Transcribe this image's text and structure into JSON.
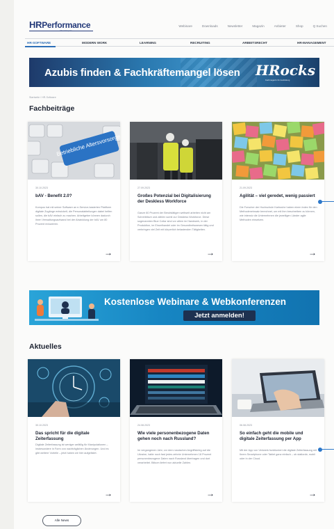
{
  "header": {
    "logo_hr": "HR",
    "logo_performance": "Performance",
    "logo_tagline": "Wissen für Experten",
    "top_links": [
      "Webinare",
      "Downloads",
      "Newsletter",
      "Magazin",
      "Anbieter",
      "Shop",
      "Q Suchen"
    ]
  },
  "nav": {
    "items": [
      "HR-SOFTWARE",
      "MODERN WORK",
      "LEARNING",
      "RECRUITING",
      "ARBEITSRECHT",
      "HR-MANAGEMENT"
    ],
    "active": "HR-SOFTWARE"
  },
  "banner_top": {
    "text": "Azubis finden & Fachkräftemangel lösen",
    "brand": "HRocks",
    "brand_sub": "Fachmagazin für Ausbildung"
  },
  "breadcrumb": "Startseite / HR-Software",
  "fachbeitraege": {
    "title": "Fachbeiträge",
    "cards": [
      {
        "image_label": "Betriebliche Altersvorsorge",
        "date": "30.10.2023",
        "title": "bAV - Benefit 2.0?",
        "body": "Kompus hat mit seiner Software an e-Service-basierten Plattform digitale Zugänge entwickelt, die Personalabteilungen dabei helfen sollen, die bAV einfach zu machen. Arbeitgeber können dadurch ihren Verwaltungsaufwand bei der Abwicklung der bAV um 80 Prozent reduzieren."
      },
      {
        "date": "27.09.2023",
        "title": "Großes Potenzial bei Digitalisierung der Deskless Workforce",
        "body": "Ganze 80 Prozent der Berufstätigen weltweit arbeiten nicht am Schreibtisch und zählen somit zur Deskless Workforce. Diese sogenannten Blue Collar sind vor allem im Handwerk, in der Produktion, im Einzelhandel oder im Gesundheitswesen tätig und verbringen viel Zeit mit körperlich belastenden Tätigkeiten."
      },
      {
        "date": "21.09.2023",
        "title": "Agilität – viel geredet, wenig passiert",
        "body": "Die Forscher der Hochschule Karlsruhe haben einen Index für den Methodeneinsatz berechnet, um mit ihm beschreiben zu können, wie intensiv die Unternehmen die jeweiligen Länder agile Methoden einsetzen."
      }
    ]
  },
  "banner_webinar": {
    "title": "Kostenlose Webinare & Webkonferenzen",
    "button": "Jetzt anmelden!"
  },
  "aktuelles": {
    "title": "Aktuelles",
    "cards": [
      {
        "date": "30.10.2023",
        "title": "Das spricht für die digitale Zeiterfassung",
        "body": "Digitale Zeiterfassung ist weniger anfällig für Manipulationen – insbesondere in Form von nachträglichen Änderungen. Und es gibt weitere Vorteile – jetzt haben wir hier aufgelistet."
      },
      {
        "date": "24.08.2023",
        "title": "Wie viele personenbezogene Daten gehen noch nach Russland?",
        "body": "Im vergangenen Jahr, vor dem russischen Angriffskrieg auf die Ukraine, hatte noch fast jedes zehnte Unternehmen 18 Prozent personenbezogene Daten nach Russland übertragen und dort verarbeitet. Bitkom liefert nun aktuelle Zahlen."
      },
      {
        "date": "06.08.2023",
        "title": "So einfach geht die mobile und digitale Zeiterfassung per App",
        "body": "Mit der App von Veriwerk funktioniert die digitale Zeiterfassung mit Ihrem Smartphone oder Tablet ganz einfach – ob stationär, mobil oder in der Cloud."
      }
    ]
  },
  "all_news_button": "Alle News",
  "colors": {
    "brand_blue": "#243a7a",
    "accent_blue": "#2d78c9",
    "webinar_cyan": "#1786c3"
  }
}
